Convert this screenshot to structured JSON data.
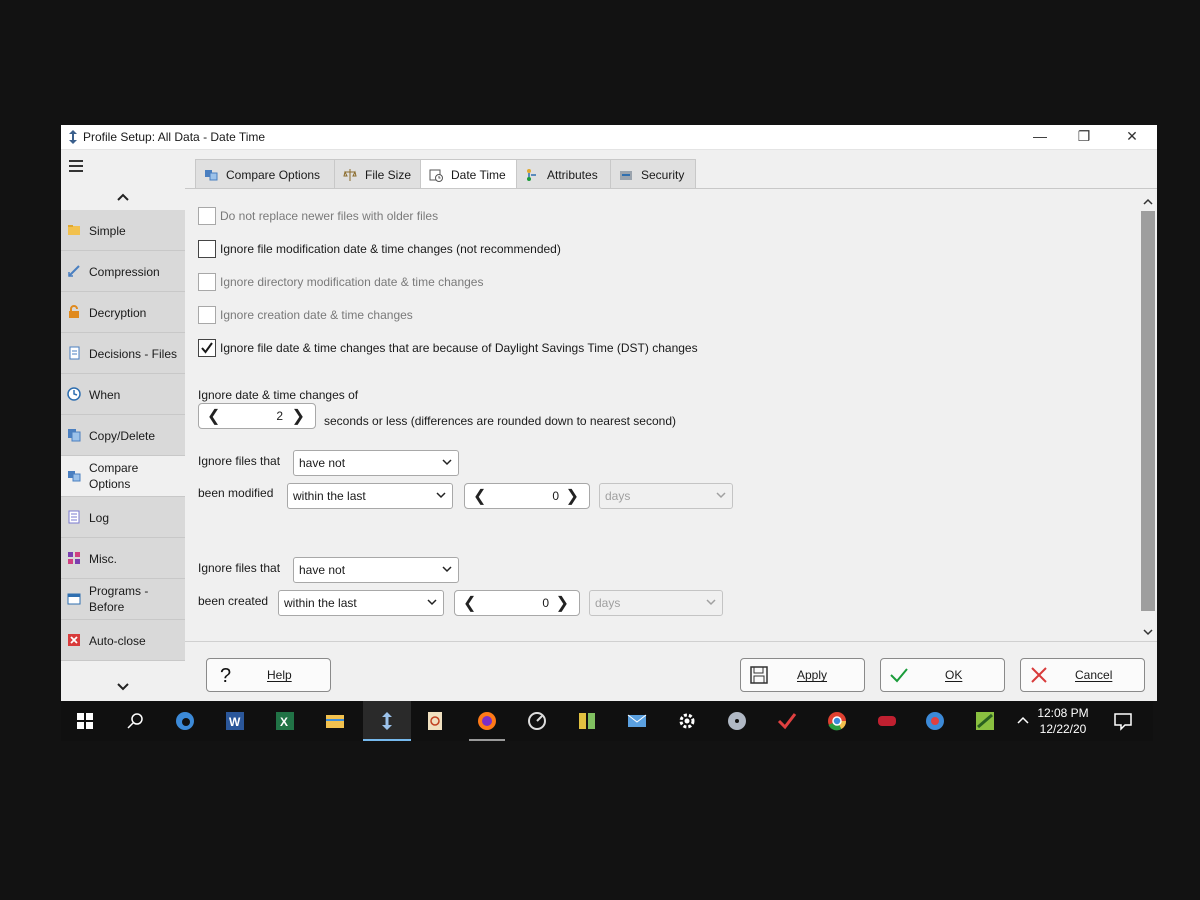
{
  "window": {
    "title": "Profile Setup: All Data - Date Time",
    "controls": {
      "minimize": "—",
      "maximize": "❐",
      "close": "✕"
    }
  },
  "sidebar": {
    "scroll_up": "⌃",
    "scroll_down": "⌄",
    "items": [
      {
        "label": "Simple",
        "icon": "folder-icon"
      },
      {
        "label": "Compression",
        "icon": "compress-icon"
      },
      {
        "label": "Decryption",
        "icon": "lock-icon"
      },
      {
        "label": "Decisions - Files",
        "icon": "document-icon"
      },
      {
        "label": "When",
        "icon": "clock-icon"
      },
      {
        "label": "Copy/Delete",
        "icon": "copy-icon"
      },
      {
        "label": "Compare Options",
        "icon": "compare-icon",
        "active": true
      },
      {
        "label": "Log",
        "icon": "log-icon"
      },
      {
        "label": "Misc.",
        "icon": "misc-icon"
      },
      {
        "label": "Programs - Before",
        "icon": "programs-icon"
      },
      {
        "label": "Auto-close",
        "icon": "autoclose-icon"
      }
    ]
  },
  "tabs": [
    {
      "label": "Compare Options",
      "icon": "compare-icon"
    },
    {
      "label": "File Size",
      "icon": "scale-icon"
    },
    {
      "label": "Date Time",
      "icon": "calendar-icon",
      "active": true
    },
    {
      "label": "Attributes",
      "icon": "attributes-icon"
    },
    {
      "label": "Security",
      "icon": "security-icon"
    }
  ],
  "options": {
    "no_replace_newer": {
      "label": "Do not replace newer files with older files",
      "checked": false,
      "enabled": false
    },
    "ignore_file_mod": {
      "label": "Ignore file modification date & time changes (not recommended)",
      "checked": false,
      "enabled": true
    },
    "ignore_dir_mod": {
      "label": "Ignore directory modification date & time changes",
      "checked": false,
      "enabled": false
    },
    "ignore_creation": {
      "label": "Ignore creation date & time changes",
      "checked": false,
      "enabled": false
    },
    "ignore_dst": {
      "label": "Ignore file date & time changes that are because of Daylight Savings Time (DST) changes",
      "checked": true,
      "enabled": true
    }
  },
  "tolerance": {
    "label": "Ignore date & time changes of",
    "value": "2",
    "suffix": "seconds or less (differences are rounded down to nearest second)"
  },
  "modified_filter": {
    "label1": "Ignore files that",
    "condition": "have not",
    "label2": "been modified",
    "range": "within the last",
    "amount": "0",
    "unit": "days"
  },
  "created_filter": {
    "label1": "Ignore files that",
    "condition": "have not",
    "label2": "been created",
    "range": "within the last",
    "amount": "0",
    "unit": "days"
  },
  "buttons": {
    "help": "Help",
    "apply": "Apply",
    "ok": "OK",
    "cancel": "Cancel"
  },
  "taskbar": {
    "time": "12:08 PM",
    "date": "12/22/20",
    "icons": [
      "windows-start-icon",
      "search-icon",
      "edge-icon",
      "word-icon",
      "excel-icon",
      "file-explorer-icon",
      "syncback-icon",
      "pdf-icon",
      "firefox-icon",
      "settings-dial-icon",
      "book-icon",
      "mail-icon",
      "gear-icon",
      "disc-icon",
      "checkmark-app-icon",
      "chrome-icon",
      "gaming-icon",
      "network-icon",
      "green-app-icon"
    ]
  },
  "colors": {
    "accent_blue": "#0078d7",
    "check_green": "#1a9c3a",
    "cancel_red": "#d83b3b",
    "taskbar_bg": "#101010"
  }
}
